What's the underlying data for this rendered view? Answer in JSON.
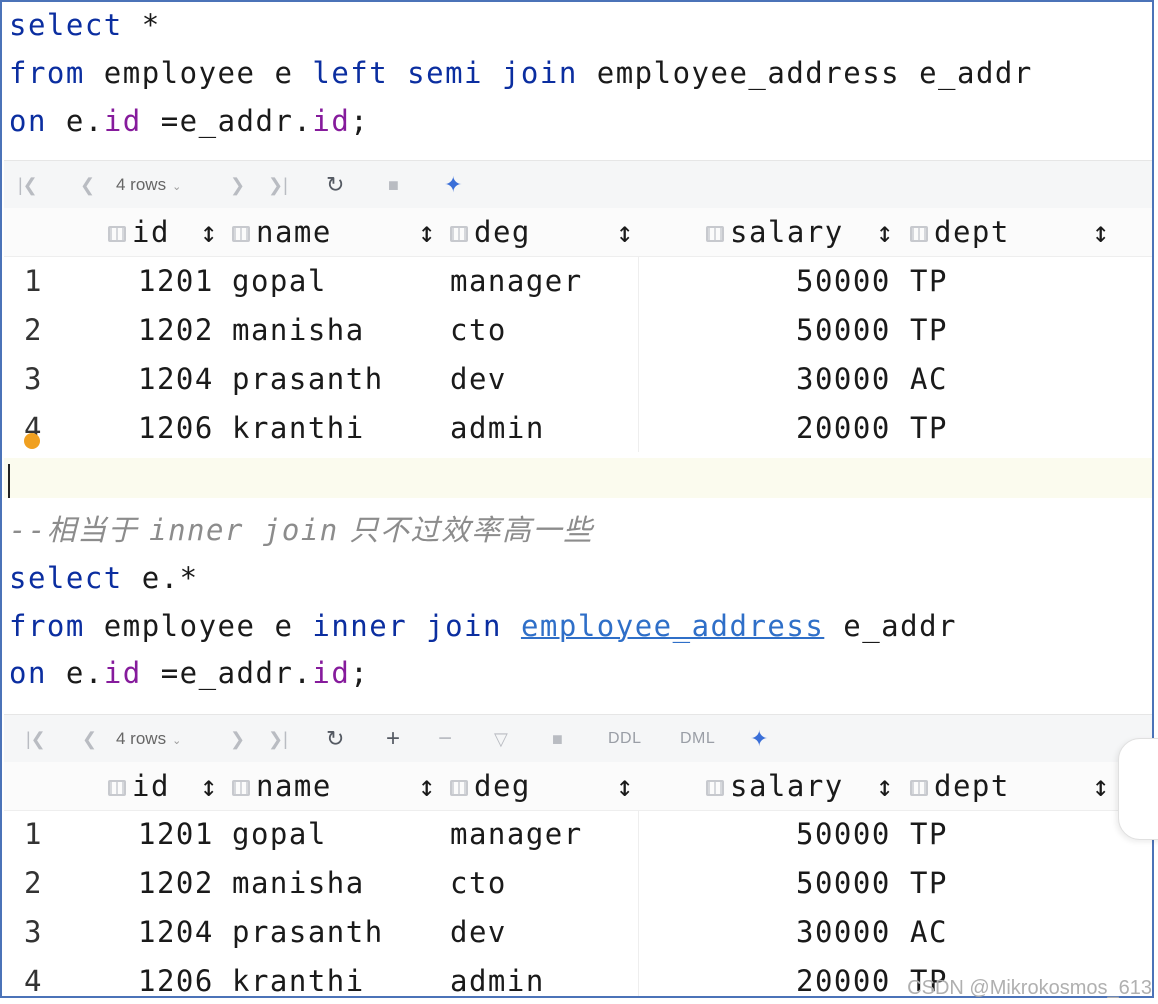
{
  "query1": {
    "line1": {
      "kw1": "select",
      "rest": " *"
    },
    "line2": {
      "kw1": "from",
      "t1": " employee e ",
      "kw2": "left semi join",
      "t2": " employee_address e_addr"
    },
    "line3": {
      "kw1": "on",
      "t1": " e.",
      "f1": "id",
      "t2": " =e_addr.",
      "f2": "id",
      "t3": ";"
    }
  },
  "toolbar1": {
    "rows_label": "4 rows",
    "icons": [
      "first-page-icon",
      "prev-page-icon",
      "next-page-icon",
      "last-page-icon",
      "refresh-icon",
      "stop-icon",
      "pin-icon"
    ]
  },
  "comment": {
    "prefix": "--",
    "cjk1": "相当于 ",
    "latin": "inner join",
    "cjk2": " 只不过效率高一些"
  },
  "query2": {
    "line1": {
      "kw1": "select",
      "rest": " e.*"
    },
    "line2": {
      "kw1": "from",
      "t1": " employee e ",
      "kw2": "inner join",
      "sp": " ",
      "link": "employee_address",
      "t2": " e_addr"
    },
    "line3": {
      "kw1": "on",
      "t1": " e.",
      "f1": "id",
      "t2": " =e_addr.",
      "f2": "id",
      "t3": ";"
    }
  },
  "toolbar2": {
    "rows_label": "4 rows",
    "ddl_label": "DDL",
    "dml_label": "DML"
  },
  "columns": [
    "id",
    "name",
    "deg",
    "salary",
    "dept"
  ],
  "result1": [
    {
      "n": "1",
      "id": "1201",
      "name": "gopal",
      "deg": "manager",
      "salary": "50000",
      "dept": "TP"
    },
    {
      "n": "2",
      "id": "1202",
      "name": "manisha",
      "deg": "cto",
      "salary": "50000",
      "dept": "TP"
    },
    {
      "n": "3",
      "id": "1204",
      "name": "prasanth",
      "deg": "dev",
      "salary": "30000",
      "dept": "AC"
    },
    {
      "n": "4",
      "id": "1206",
      "name": "kranthi",
      "deg": "admin",
      "salary": "20000",
      "dept": "TP"
    }
  ],
  "result2": [
    {
      "n": "1",
      "id": "1201",
      "name": "gopal",
      "deg": "manager",
      "salary": "50000",
      "dept": "TP"
    },
    {
      "n": "2",
      "id": "1202",
      "name": "manisha",
      "deg": "cto",
      "salary": "50000",
      "dept": "TP"
    },
    {
      "n": "3",
      "id": "1204",
      "name": "prasanth",
      "deg": "dev",
      "salary": "30000",
      "dept": "AC"
    },
    {
      "n": "4",
      "id": "1206",
      "name": "kranthi",
      "deg": "admin",
      "salary": "20000",
      "dept": "TP"
    }
  ],
  "watermark": "CSDN @Mikrokosmos_613"
}
